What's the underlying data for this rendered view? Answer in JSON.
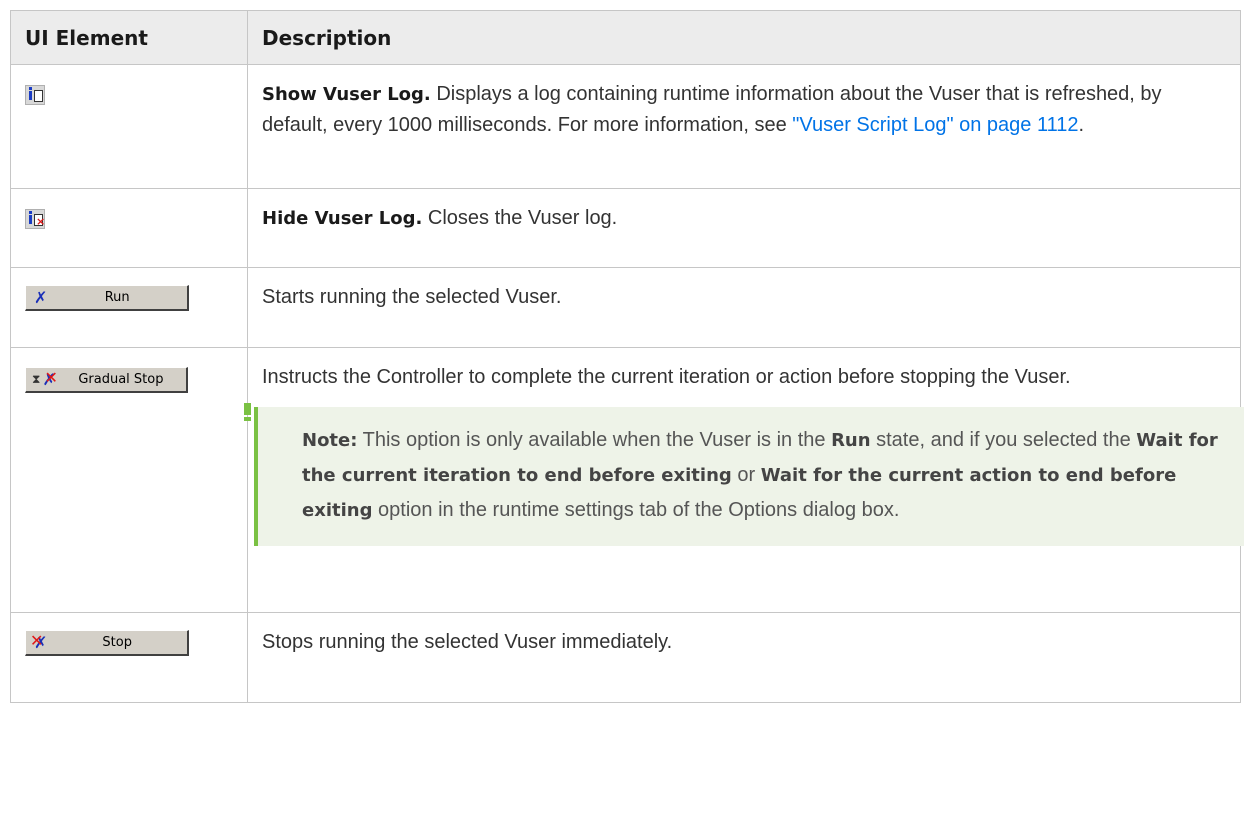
{
  "table": {
    "headers": {
      "col1": "UI Element",
      "col2": "Description"
    },
    "rows": [
      {
        "ui": {
          "icon": "show-vuser-log-icon"
        },
        "term": "Show Vuser Log.",
        "text": " Displays a log containing runtime information about the Vuser that is refreshed, by default, every 1000 milliseconds. For more information, see ",
        "link": "\"Vuser Script Log\" on page 1112",
        "after": "."
      },
      {
        "ui": {
          "icon": "hide-vuser-log-icon"
        },
        "term": "Hide Vuser Log.",
        "text": " Closes the Vuser log."
      },
      {
        "ui": {
          "button_label": "Run",
          "icon": "run-vuser-icon"
        },
        "text": "Starts running the selected Vuser."
      },
      {
        "ui": {
          "button_label": "Gradual Stop",
          "icon": "gradual-stop-icon"
        },
        "text": "Instructs the Controller to complete the current iteration or action before stopping the Vuser.",
        "note": {
          "label": "Note:",
          "t1": " This option is only available when the Vuser is in the ",
          "b1": "Run",
          "t2": " state, and if you selected the ",
          "b2": "Wait for the current iteration to end before exiting",
          "t3": " or ",
          "b3": "Wait for the current action to end before exiting",
          "t4": " option in the runtime settings tab of the Options dialog box."
        }
      },
      {
        "ui": {
          "button_label": "Stop",
          "icon": "stop-vuser-icon"
        },
        "text": "Stops running the selected Vuser immediately."
      }
    ]
  },
  "colors": {
    "link": "#0073e7",
    "note_accent": "#7ac143",
    "note_bg": "#eef3e8",
    "header_bg": "#ececec"
  }
}
